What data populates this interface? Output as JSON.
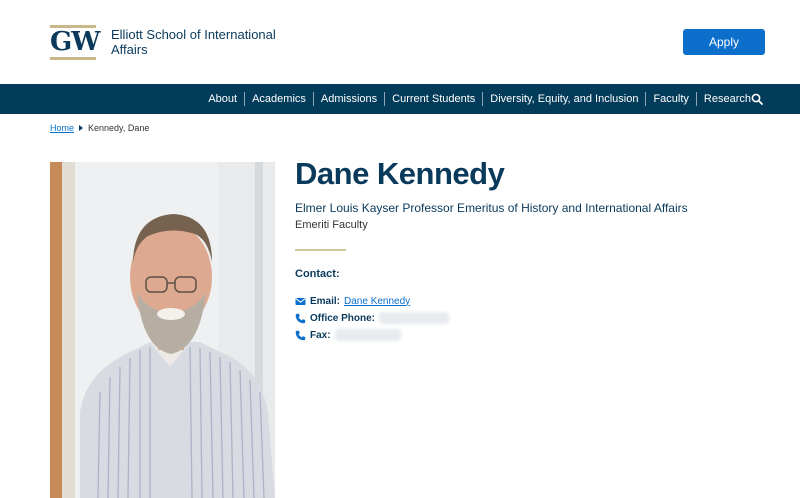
{
  "header": {
    "logo_text": "GW",
    "school_name": "Elliott School of International Affairs",
    "apply_label": "Apply"
  },
  "nav": {
    "items": [
      "About",
      "Academics",
      "Admissions",
      "Current Students",
      "Diversity, Equity, and Inclusion",
      "Faculty",
      "Research"
    ],
    "search_icon": "search-icon"
  },
  "breadcrumb": {
    "home": "Home",
    "current": "Kennedy, Dane"
  },
  "profile": {
    "name": "Dane Kennedy",
    "title": "Elmer Louis Kayser Professor Emeritus of History and International Affairs",
    "category": "Emeriti Faculty",
    "contact_heading": "Contact:",
    "email_label": "Email:",
    "email_link": "Dane Kennedy",
    "phone_label": "Office Phone:",
    "fax_label": "Fax:"
  },
  "colors": {
    "brand_navy": "#033c5a",
    "accent_gold": "#c9b98a",
    "link_blue": "#0b6fcb"
  }
}
